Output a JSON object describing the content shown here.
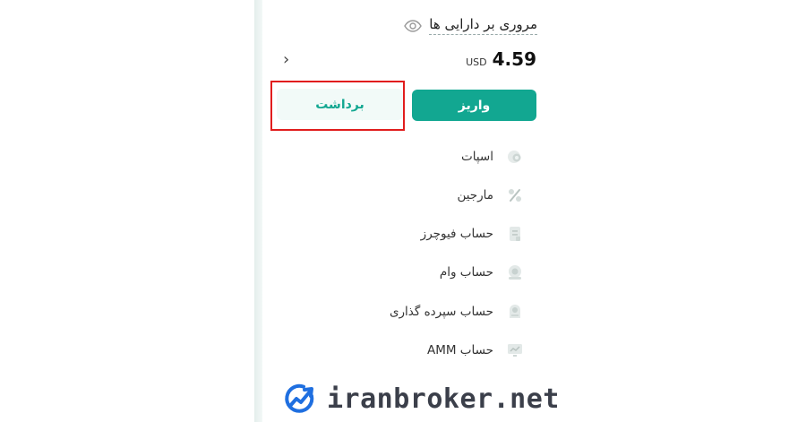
{
  "header": {
    "overview_label": "مروری بر دارایی ها",
    "eye_icon": "eye-icon"
  },
  "balance": {
    "amount": "4.59",
    "currency": "USD",
    "chevron_icon": "chevron-right-icon"
  },
  "actions": {
    "deposit_label": "واریز",
    "withdraw_label": "برداشت",
    "highlight_color": "#e11d1d"
  },
  "menu": {
    "items": [
      {
        "label": "اسپات",
        "icon": "coin-icon"
      },
      {
        "label": "مارجین",
        "icon": "percent-icon"
      },
      {
        "label": "حساب فیوچرز",
        "icon": "document-icon"
      },
      {
        "label": "حساب وام",
        "icon": "loan-icon"
      },
      {
        "label": "حساب سپرده گذاری",
        "icon": "deposit-account-icon"
      },
      {
        "label": "حساب AMM",
        "icon": "monitor-icon"
      }
    ]
  },
  "colors": {
    "accent": "#12a791",
    "accent_light": "#f2faf8"
  },
  "watermark": {
    "text": "iranbroker.net",
    "icon": "chart-logo-icon"
  }
}
